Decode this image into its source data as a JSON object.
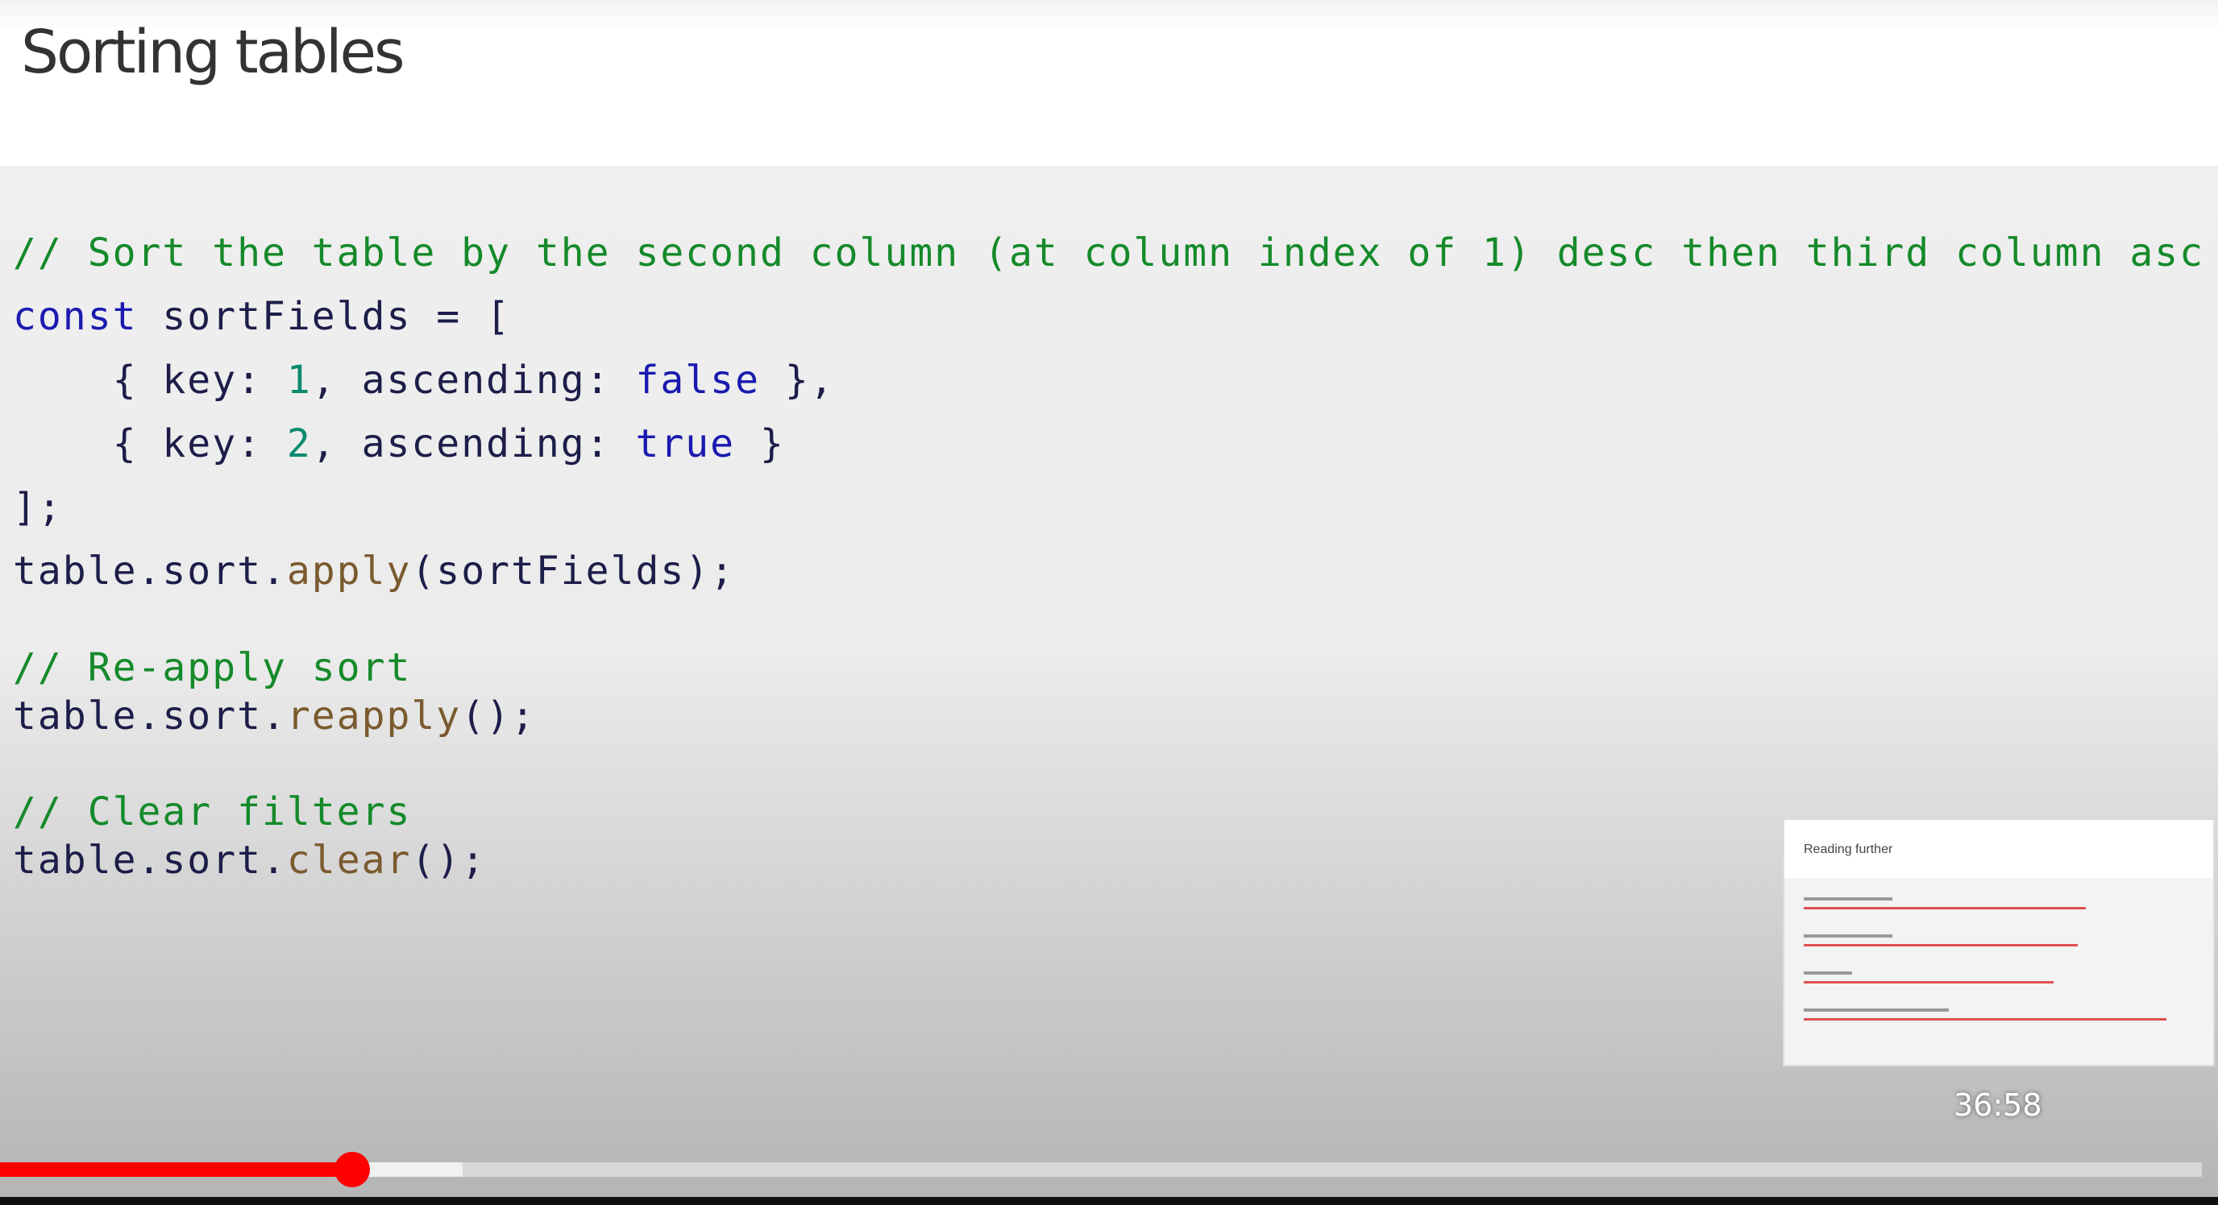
{
  "slide": {
    "title": "Sorting tables"
  },
  "code": {
    "lines": [
      {
        "tokens": [
          {
            "t": "// Sort the table by the second column (at column index of 1) desc then third column asc",
            "k": "comment"
          }
        ]
      },
      {
        "tokens": [
          {
            "t": "const",
            "k": "keyword"
          },
          {
            "t": " sortFields = [",
            "k": "ident"
          }
        ]
      },
      {
        "tokens": [
          {
            "t": "    { key: ",
            "k": "ident"
          },
          {
            "t": "1",
            "k": "number"
          },
          {
            "t": ", ascending: ",
            "k": "ident"
          },
          {
            "t": "false",
            "k": "keyword"
          },
          {
            "t": " },",
            "k": "ident"
          }
        ]
      },
      {
        "tokens": [
          {
            "t": "    { key: ",
            "k": "ident"
          },
          {
            "t": "2",
            "k": "number"
          },
          {
            "t": ", ascending: ",
            "k": "ident"
          },
          {
            "t": "true",
            "k": "keyword"
          },
          {
            "t": " }",
            "k": "ident"
          }
        ]
      },
      {
        "tokens": [
          {
            "t": "];",
            "k": "ident"
          }
        ]
      },
      {
        "tokens": [
          {
            "t": "table.sort.",
            "k": "ident"
          },
          {
            "t": "apply",
            "k": "method"
          },
          {
            "t": "(sortFields);",
            "k": "ident"
          }
        ]
      },
      {
        "tokens": [
          {
            "t": "// Re-apply sort",
            "k": "comment"
          }
        ]
      },
      {
        "tokens": [
          {
            "t": "table.sort.",
            "k": "ident"
          },
          {
            "t": "reapply",
            "k": "method"
          },
          {
            "t": "();",
            "k": "ident"
          }
        ]
      },
      {
        "tokens": [
          {
            "t": "// Clear filters",
            "k": "comment"
          }
        ]
      },
      {
        "tokens": [
          {
            "t": "table.sort.",
            "k": "ident"
          },
          {
            "t": "clear",
            "k": "method"
          },
          {
            "t": "();",
            "k": "ident"
          }
        ]
      }
    ]
  },
  "player": {
    "preview_time": "36:58",
    "preview_title": "Reading further",
    "played_fraction": 0.16,
    "buffered_fraction": 0.21
  },
  "colors": {
    "comment": "#158a2a",
    "keyword": "#1a1ab0",
    "number": "#0b8a6e",
    "method": "#7a5a2e",
    "progress": "#ff0000"
  }
}
